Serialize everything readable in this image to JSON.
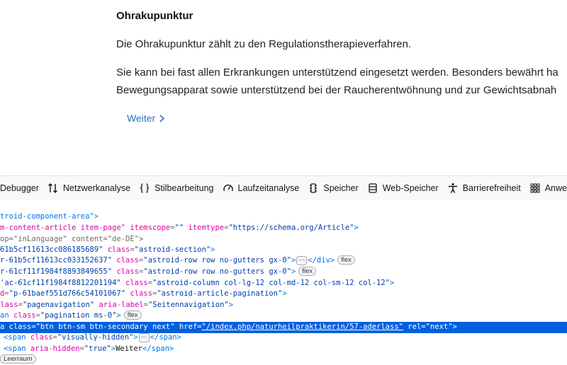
{
  "article": {
    "title": "Ohrakupunktur",
    "paragraph1": "Die Ohrakupunktur zählt zu den Regulationstherapieverfahren.",
    "paragraph2_line1": "Sie kann bei fast allen Erkrankungen unterstützend eingesetzt werden. Besonders bewährt ha",
    "paragraph2_line2": "Bewegungsapparat sowie unterstützend bei der Raucherentwöhnung und zur Gewichtsabnah",
    "next_link": "Weiter"
  },
  "toolbar": {
    "tabs": [
      {
        "label": "Debugger",
        "icon": "debugger-icon"
      },
      {
        "label": "Netzwerkanalyse",
        "icon": "network-arrows-icon"
      },
      {
        "label": "Stilbearbeitung",
        "icon": "braces-icon"
      },
      {
        "label": "Laufzeitanalyse",
        "icon": "gauge-icon"
      },
      {
        "label": "Speicher",
        "icon": "memory-chip-icon"
      },
      {
        "label": "Web-Speicher",
        "icon": "storage-icon"
      },
      {
        "label": "Barrierefreiheit",
        "icon": "accessibility-icon"
      },
      {
        "label": "Anwendung",
        "icon": "grid-icon"
      }
    ]
  },
  "inspector": {
    "l0": {
      "t1": "troid-component-area\">"
    },
    "l1": {
      "a1": "m-content-article item-page\"",
      "a2": " itemscope",
      "p1": "=",
      "v1": "\"\"",
      "a3": " itemtype",
      "p2": "=",
      "v2": "\"https://schema.org/Article\"",
      "t1": ">"
    },
    "l2": {
      "p1": "op=\"inLanguage\" content=\"de-DE\">"
    },
    "l3": {
      "v1": "61b5cf11613cc086185689\"",
      "a1": " class",
      "p1": "=",
      "v2": "\"astroid-section\"",
      "t1": ">"
    },
    "l4": {
      "v1": "r-61b5cf11613cc033152637\"",
      "a1": " class",
      "p1": "=",
      "v2": "\"astroid-row row no-gutters gx-0\"",
      "t1": ">",
      "tx1": "</div>",
      "badge": "flex"
    },
    "l5": {
      "v1": "r-61cf11f1984f8893849655\"",
      "a1": " class",
      "p1": "=",
      "v2": "\"astroid-row row no-gutters gx-0\"",
      "t1": ">",
      "badge": "flex"
    },
    "l6": {
      "v1": "'ac-61cf11f1984f8812201194\"",
      "a1": " class",
      "p1": "=",
      "v2": "\"astroid-column col-lg-12 col-md-12 col-sm-12 col-12\"",
      "t1": ">"
    },
    "l7": {
      "a1": "d",
      "p1": "=",
      "v1": "\"p-61baef551d766c54101067\"",
      "a2": " class",
      "p2": "=",
      "v2": "\"astroid-article-pagination\"",
      "t1": ">"
    },
    "l8": {
      "a1": " class",
      "p1": "=",
      "v1": "\"pagenavigation\"",
      "a2": " aria-label",
      "p2": "=",
      "v2": "\"Seitennavigation\"",
      "t1": ">"
    },
    "l9": {
      "t1": "an",
      "a1": " class",
      "p1": "=",
      "v1": "\"pagination ms-0\"",
      "t2": ">",
      "badge": "flex"
    },
    "l10": {
      "t1": "a",
      "a1": " class",
      "p1": "=",
      "v1": "\"btn btn-sm btn-secondary next\"",
      "a2": " href",
      "p2": "=",
      "v2": "\"/index.php/naturheilpraktikerin/57-aderlass\"",
      "a3": " rel",
      "p3": "=",
      "v3": "\"next\"",
      "t2": ">"
    },
    "l11": {
      "t1": "<span",
      "a1": " class",
      "p1": "=",
      "v1": "\"visually-hidden\"",
      "t2": ">",
      "t3": "</span>"
    },
    "l12": {
      "t1": "<span",
      "a1": " aria-hidden",
      "p1": "=",
      "v1": "\"true\"",
      "t2": ">",
      "tx1": "Weiter",
      "t3": "</span>"
    },
    "l13": {
      "badge": "Leerraum"
    }
  }
}
